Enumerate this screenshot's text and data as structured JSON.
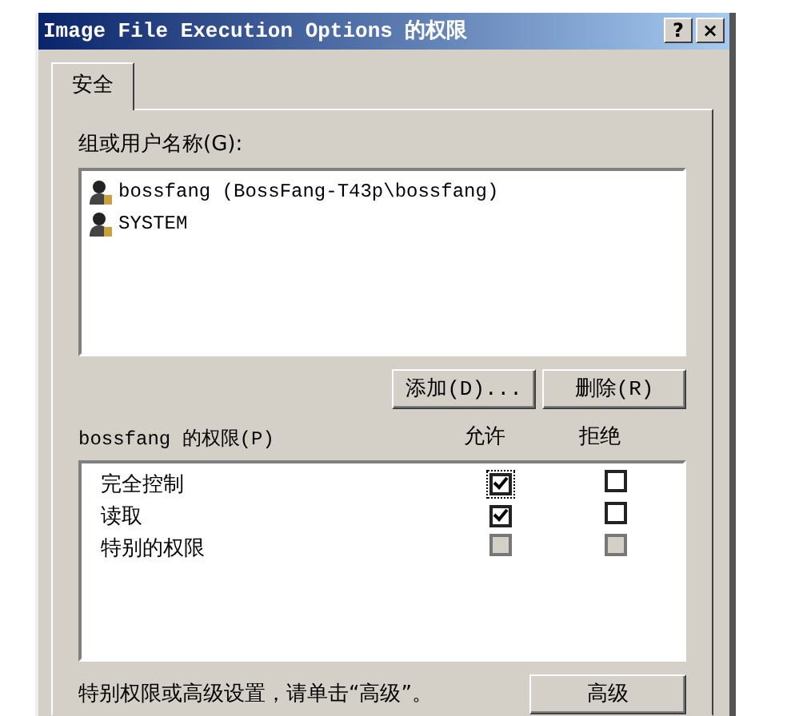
{
  "window": {
    "title": "Image File Execution Options 的权限",
    "buttons": [
      "?",
      "×"
    ]
  },
  "tabs": [
    {
      "label": "安全",
      "selected": true
    }
  ],
  "principals_label": "组或用户名称(G):",
  "principals": [
    {
      "name": "bossfang (BossFang-T43p\\bossfang)",
      "selected": false
    },
    {
      "name": "SYSTEM",
      "selected": false
    }
  ],
  "principal_buttons": [
    "添加(D)...",
    "删除(R)"
  ],
  "permissions_label": "bossfang 的权限(P)",
  "columns": [
    "允许",
    "拒绝"
  ],
  "permissions": [
    {
      "name": "完全控制",
      "allow": true,
      "deny": false,
      "disabled": false,
      "focused": true
    },
    {
      "name": "读取",
      "allow": true,
      "deny": false,
      "disabled": false,
      "focused": false
    },
    {
      "name": "特别的权限",
      "allow": false,
      "deny": false,
      "disabled": true,
      "focused": false
    }
  ],
  "footer_text": "特别权限或高级设置，请单击“高级”。",
  "advanced_button": "高级"
}
